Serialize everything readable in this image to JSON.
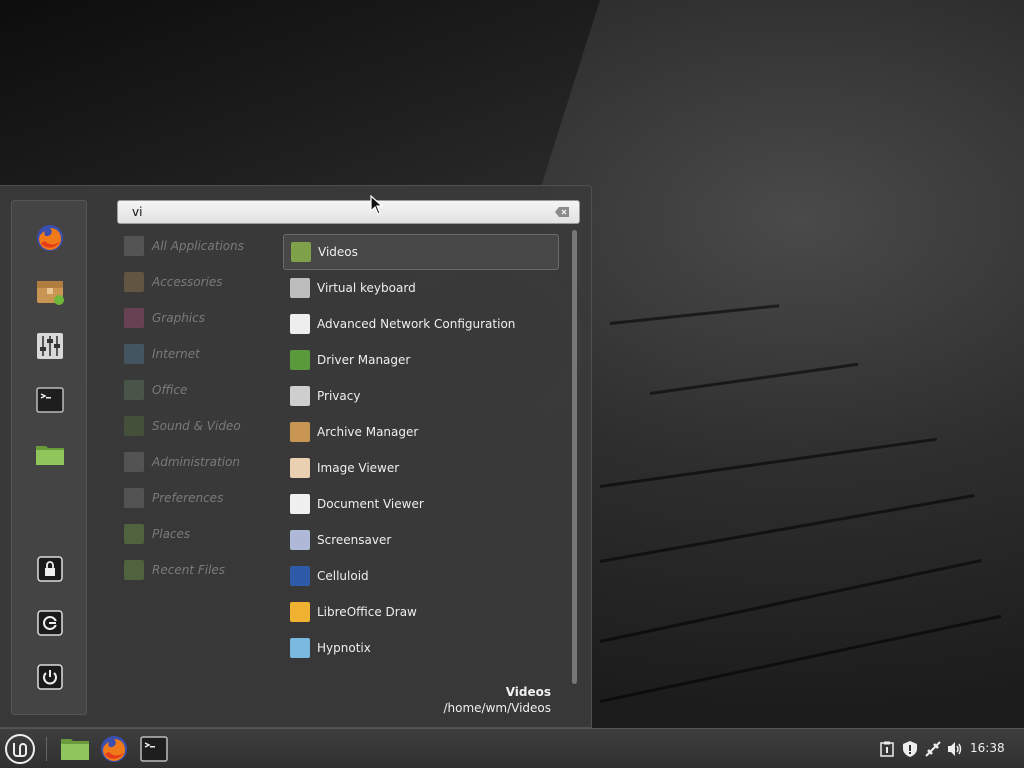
{
  "search": {
    "value": "vi",
    "placeholder": ""
  },
  "favorites": [
    {
      "name": "firefox-icon",
      "color": "#e66000"
    },
    {
      "name": "archive-manager-icon",
      "color": "#c99552"
    },
    {
      "name": "settings-icon",
      "color": "#d8d8d8"
    },
    {
      "name": "terminal-icon",
      "color": "#2a2a2a"
    },
    {
      "name": "files-icon",
      "color": "#7fb24a"
    }
  ],
  "session": [
    {
      "name": "lock-screen-icon"
    },
    {
      "name": "logout-icon"
    },
    {
      "name": "shutdown-icon"
    }
  ],
  "categories": [
    {
      "label": "All Applications",
      "color": "#888"
    },
    {
      "label": "Accessories",
      "color": "#b08a50"
    },
    {
      "label": "Graphics",
      "color": "#c05080"
    },
    {
      "label": "Internet",
      "color": "#5a8ab0"
    },
    {
      "label": "Office",
      "color": "#6a8a6a"
    },
    {
      "label": "Sound & Video",
      "color": "#5a7a3a"
    },
    {
      "label": "Administration",
      "color": "#888"
    },
    {
      "label": "Preferences",
      "color": "#888"
    },
    {
      "label": "Places",
      "color": "#7fb24a"
    },
    {
      "label": "Recent Files",
      "color": "#7fb24a"
    }
  ],
  "apps": [
    {
      "label": "Videos",
      "icon": "videos-icon",
      "color": "#7fa14a"
    },
    {
      "label": "Virtual keyboard",
      "icon": "keyboard-icon",
      "color": "#bdbdbd"
    },
    {
      "label": "Advanced Network Configuration",
      "icon": "network-icon",
      "color": "#eeeeee"
    },
    {
      "label": "Driver Manager",
      "icon": "driver-manager-icon",
      "color": "#5a9a3a"
    },
    {
      "label": "Privacy",
      "icon": "privacy-icon",
      "color": "#cfcfcf"
    },
    {
      "label": "Archive Manager",
      "icon": "archive-manager-icon",
      "color": "#c99552"
    },
    {
      "label": "Image Viewer",
      "icon": "image-viewer-icon",
      "color": "#e8d0b0"
    },
    {
      "label": "Document Viewer",
      "icon": "document-viewer-icon",
      "color": "#f0f0f0"
    },
    {
      "label": "Screensaver",
      "icon": "screensaver-icon",
      "color": "#b0b8d8"
    },
    {
      "label": "Celluloid",
      "icon": "celluloid-icon",
      "color": "#2e5aa8"
    },
    {
      "label": "LibreOffice Draw",
      "icon": "libreoffice-draw-icon",
      "color": "#f0b030"
    },
    {
      "label": "Hypnotix",
      "icon": "hypnotix-icon",
      "color": "#7ab8e0"
    }
  ],
  "selected_info": {
    "title": "Videos",
    "path": "/home/wm/Videos"
  },
  "taskbar": {
    "clock": "16:38"
  }
}
